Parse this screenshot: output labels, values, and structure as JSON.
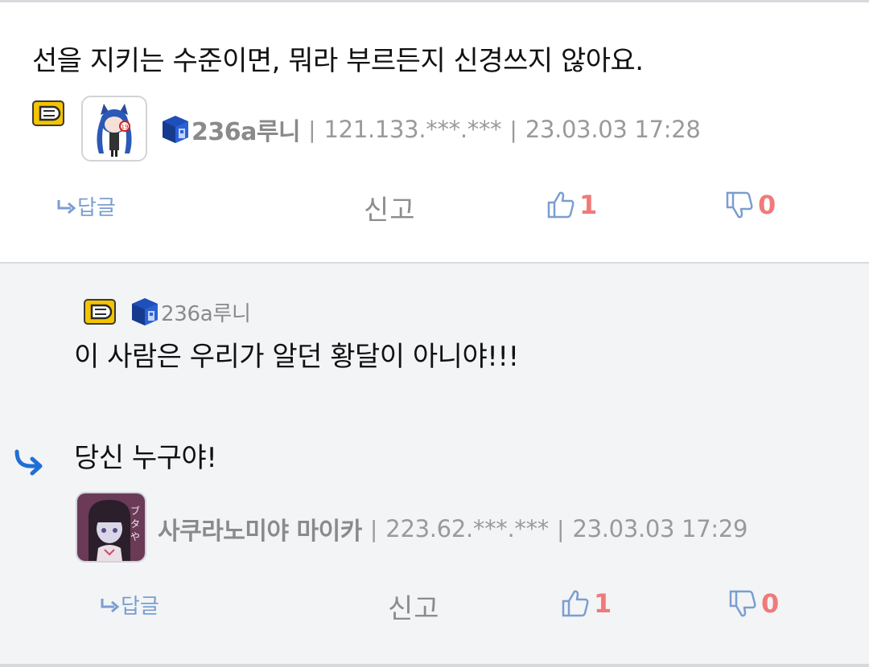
{
  "main_comment": {
    "text": "선을 지키는 수준이면, 뭐라 부르든지 신경쓰지 않아요.",
    "nickname": "236a루니",
    "ip": "121.133.***.***",
    "datetime": "23.03.03 17:28",
    "reply_label": "답글",
    "report_label": "신고",
    "upvotes": "1",
    "downvotes": "0"
  },
  "reply_comment": {
    "mention_nickname": "236a루니",
    "line1": "이 사람은 우리가 알던 황달이 아니야!!!",
    "line2": "당신 누구야!",
    "nickname": "사쿠라노미야 마이카",
    "ip": "223.62.***.***",
    "datetime": "23.03.03 17:29",
    "reply_label": "답글",
    "report_label": "신고",
    "upvotes": "1",
    "downvotes": "0"
  },
  "separator": "|",
  "colors": {
    "vote_count": "#f07a7a",
    "link_blue": "#7a9ed0",
    "meta_gray": "#9a9a9a",
    "reply_bg": "#f3f4f6",
    "badge_yellow": "#f5c400",
    "level_blue": "#1f4fb8"
  },
  "icons": {
    "badge": "fixed-nick-badge-icon",
    "level": "level-cube-icon",
    "thumbs_up": "thumbs-up-icon",
    "thumbs_down": "thumbs-down-icon",
    "reply_arrow": "reply-arrow-icon"
  }
}
